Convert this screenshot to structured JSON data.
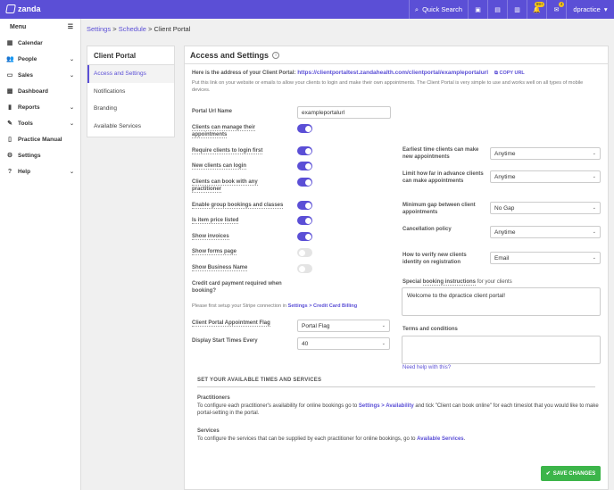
{
  "app": {
    "name": "zanda"
  },
  "topbar": {
    "search_label": "Quick Search",
    "user": "dpractice",
    "badge_1": "99+",
    "badge_2": "4"
  },
  "sidebar": {
    "menu_label": "Menu",
    "items": [
      {
        "label": "Calendar",
        "icon": "calendar-icon"
      },
      {
        "label": "People",
        "icon": "people-icon"
      },
      {
        "label": "Sales",
        "icon": "sales-icon"
      },
      {
        "label": "Dashboard",
        "icon": "dashboard-icon"
      },
      {
        "label": "Reports",
        "icon": "reports-icon"
      },
      {
        "label": "Tools",
        "icon": "tools-icon"
      },
      {
        "label": "Practice Manual",
        "icon": "book-icon"
      },
      {
        "label": "Settings",
        "icon": "gear-icon"
      },
      {
        "label": "Help",
        "icon": "help-icon"
      }
    ]
  },
  "breadcrumb": {
    "settings": "Settings",
    "schedule": "Schedule",
    "current": "Client Portal",
    "sep": ">"
  },
  "subnav": {
    "title": "Client Portal",
    "items": [
      "Access and Settings",
      "Notifications",
      "Branding",
      "Available Services"
    ]
  },
  "main": {
    "title": "Access and Settings",
    "address_label": "Here is the address of your Client Portal:",
    "address_url": "https://clientportaltest.zandahealth.com/clientportal/exampleportalurl",
    "copy_url": "COPY URL",
    "description": "Put this link on your website or emails to allow your clients to login and make their own appointments. The Client Portal is very simple to use and works well on all types of mobile devices.",
    "portal_url_label": "Portal Url Name",
    "portal_url_value": "exampleportalurl",
    "left_settings": [
      {
        "label": "Clients can manage their appointments",
        "on": true
      },
      {
        "label": "Require clients to login first",
        "on": true
      },
      {
        "label": "New clients can login",
        "on": true
      },
      {
        "label": "Clients can book with any practitioner",
        "on": true
      },
      {
        "label": "Enable group bookings and classes",
        "on": true
      },
      {
        "label": "Is item price listed",
        "on": true
      },
      {
        "label": "Show invoices",
        "on": true
      },
      {
        "label": "Show forms page",
        "on": false
      },
      {
        "label": "Show Business Name",
        "on": false
      }
    ],
    "credit_card_label": "Credit card payment required when booking?",
    "stripe_note_prefix": "Please first setup your Stripe connection in",
    "stripe_link": "Settings > Credit Card Billing",
    "right_settings": [
      {
        "label": "Earliest time clients can make new appointments",
        "value": "Anytime"
      },
      {
        "label": "Limit how far in advance clients can make appointments",
        "value": "Anytime"
      },
      {
        "label": "Minimum gap between client appointments",
        "value": "No Gap"
      },
      {
        "label": "Cancellation policy",
        "value": "Anytime"
      },
      {
        "label": "How to verify new clients identity on registration",
        "value": "Email"
      }
    ],
    "special_label_prefix": "Special",
    "special_label_link": "booking instructions",
    "special_label_suffix": "for your clients",
    "special_value": "Welcome to the dpractice client portal!",
    "terms_label": "Terms and conditions",
    "help_link": "Need help with this?",
    "flag_label": "Client Portal Appointment Flag",
    "flag_value": "Portal Flag",
    "start_times_label": "Display Start Times Every",
    "start_times_value": "40",
    "section_title": "SET YOUR AVAILABLE TIMES AND SERVICES",
    "practitioners_title": "Practitioners",
    "practitioners_prefix": "To configure each practitioner's availability for online bookings go to",
    "practitioners_link": "Settings > Availability",
    "practitioners_suffix": "and tick \"Client can book online\" for each timeslot that you would like to make portal-setting in the portal.",
    "services_title": "Services",
    "services_prefix": "To configure the services that can be supplied by each practitioner for online bookings, go to",
    "services_link": "Available Services",
    "services_suffix": "."
  },
  "save_button": "SAVE CHANGES",
  "colors": {
    "accent": "#5b4fd6",
    "save": "#3cb54a",
    "topbar": "#5b4fd6"
  }
}
